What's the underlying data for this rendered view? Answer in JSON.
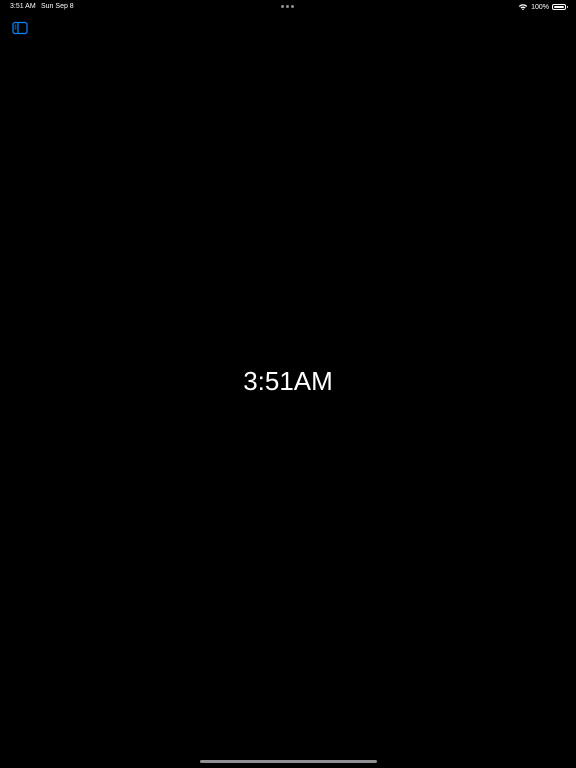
{
  "status_bar": {
    "time": "3:51 AM",
    "date": "Sun Sep 8",
    "battery_percent": "100%",
    "battery_level": 1.0,
    "wifi_icon": "wifi-icon",
    "battery_icon": "battery-icon"
  },
  "toolbar": {
    "sidebar_icon": "sidebar-toggle-icon"
  },
  "clock": {
    "time": "3:51AM"
  },
  "colors": {
    "background": "#000000",
    "accent": "#0a84ff",
    "text": "#ffffff",
    "muted": "#8e8e93"
  }
}
